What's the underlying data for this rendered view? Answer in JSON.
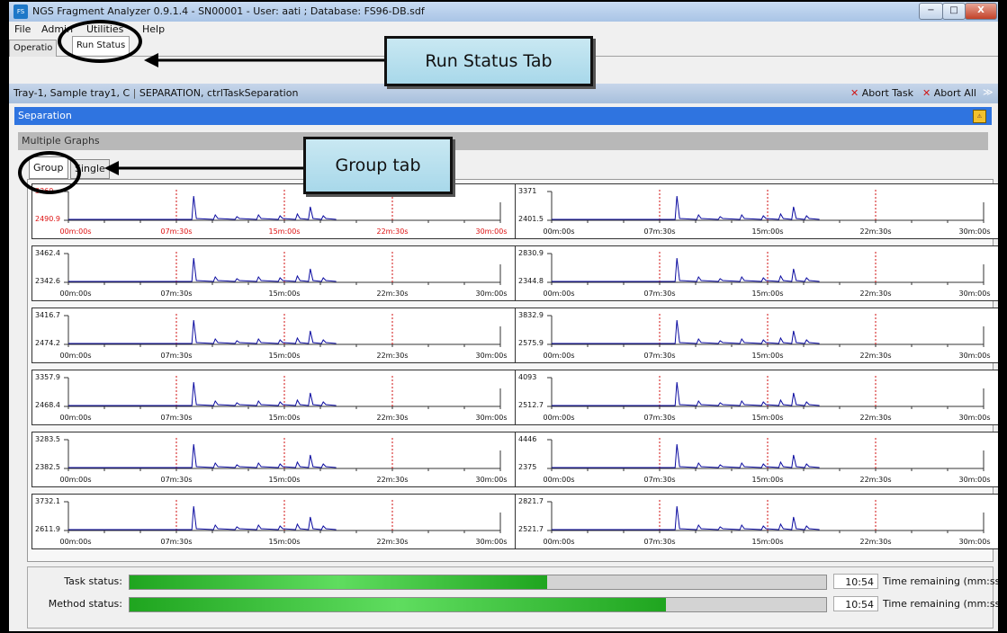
{
  "window": {
    "title": "NGS Fragment Analyzer 0.9.1.4 - SN00001 - User: aati ; Database: FS96-DB.sdf",
    "app_icon": "FS"
  },
  "window_controls": {
    "minimize": "−",
    "maximize": "□",
    "close": "X"
  },
  "menu": [
    "File",
    "Admin",
    "Utilities",
    "Help"
  ],
  "top_tabs": [
    "Operatio",
    "Run Status"
  ],
  "task_bar": {
    "sample": "Tray-1, Sample tray1, C",
    "task": "SEPARATION, ctrlTaskSeparation",
    "abort_task": "Abort Task",
    "abort_all": "Abort All"
  },
  "separation": {
    "title": "Separation"
  },
  "multiple_graphs": {
    "title": "Multiple Graphs"
  },
  "group_tabs": [
    "Group",
    "Single"
  ],
  "x_ticks": [
    "00m:00s",
    "07m:30s",
    "15m:00s",
    "22m:30s",
    "30m:00s"
  ],
  "graphs": [
    {
      "ymax": "3360",
      "ymin": "2490.9",
      "highlight": true
    },
    {
      "ymax": "3371",
      "ymin": "2401.5",
      "highlight": false
    },
    {
      "ymax": "3462.4",
      "ymin": "2342.6",
      "highlight": false
    },
    {
      "ymax": "2830.9",
      "ymin": "2344.8",
      "highlight": false
    },
    {
      "ymax": "3416.7",
      "ymin": "2474.2",
      "highlight": false
    },
    {
      "ymax": "3832.9",
      "ymin": "2575.9",
      "highlight": false
    },
    {
      "ymax": "3357.9",
      "ymin": "2468.4",
      "highlight": false
    },
    {
      "ymax": "4093",
      "ymin": "2512.7",
      "highlight": false
    },
    {
      "ymax": "3283.5",
      "ymin": "2382.5",
      "highlight": false
    },
    {
      "ymax": "4446",
      "ymin": "2375",
      "highlight": false
    },
    {
      "ymax": "3732.1",
      "ymin": "2611.9",
      "highlight": false
    },
    {
      "ymax": "2821.7",
      "ymin": "2521.7",
      "highlight": false
    }
  ],
  "status": {
    "task_label": "Task status:",
    "task_progress": 0.6,
    "task_time": "10:54",
    "method_label": "Method status:",
    "method_progress": 0.77,
    "method_time": "10:54",
    "time_label": "Time remaining (mm:ss)"
  },
  "annotations": {
    "run_status_callout": "Run Status Tab",
    "group_callout": "Group tab"
  },
  "colors": {
    "accent_blue": "#2f74e0",
    "trace": "#0a0aa0",
    "marker": "#d11111",
    "progress": "#2fb82f"
  }
}
